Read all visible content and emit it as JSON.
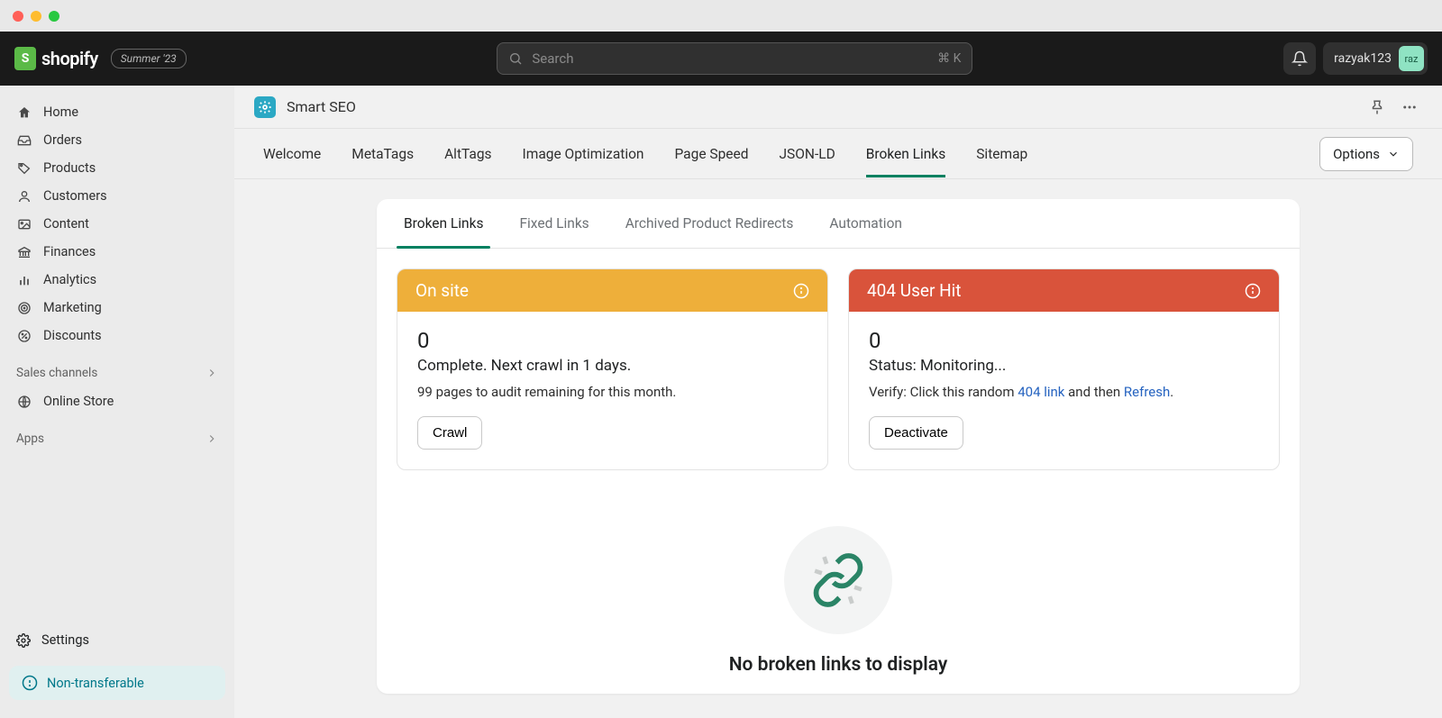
{
  "window_title": "shopify",
  "header": {
    "brand": "shopify",
    "badge": "Summer '23",
    "search_placeholder": "Search",
    "search_shortcut": "⌘ K",
    "username": "razyak123",
    "avatar_initials": "raz"
  },
  "sidebar": {
    "items": [
      {
        "label": "Home",
        "icon": "home"
      },
      {
        "label": "Orders",
        "icon": "inbox"
      },
      {
        "label": "Products",
        "icon": "tag"
      },
      {
        "label": "Customers",
        "icon": "user"
      },
      {
        "label": "Content",
        "icon": "image"
      },
      {
        "label": "Finances",
        "icon": "bank"
      },
      {
        "label": "Analytics",
        "icon": "bars"
      },
      {
        "label": "Marketing",
        "icon": "target"
      },
      {
        "label": "Discounts",
        "icon": "discount"
      }
    ],
    "sections": [
      {
        "label": "Sales channels"
      },
      {
        "label": "Apps"
      }
    ],
    "online_store": "Online Store",
    "settings": "Settings",
    "bottom_badge": "Non-transferable"
  },
  "app": {
    "title": "Smart SEO",
    "tabs": [
      "Welcome",
      "MetaTags",
      "AltTags",
      "Image Optimization",
      "Page Speed",
      "JSON-LD",
      "Broken Links",
      "Sitemap"
    ],
    "active_tab": "Broken Links",
    "options_label": "Options"
  },
  "subtabs": {
    "items": [
      "Broken Links",
      "Fixed Links",
      "Archived Product Redirects",
      "Automation"
    ],
    "active": "Broken Links"
  },
  "panels": {
    "onsite": {
      "title": "On site",
      "count": "0",
      "status": "Complete. Next crawl in 1 days.",
      "subtext": "99 pages to audit remaining for this month.",
      "button": "Crawl"
    },
    "userhit": {
      "title": "404 User Hit",
      "count": "0",
      "status": "Status: Monitoring...",
      "verify_prefix": "Verify: Click this random ",
      "verify_link1": "404 link",
      "verify_mid": " and then ",
      "verify_link2": "Refresh",
      "verify_suffix": ".",
      "button": "Deactivate"
    }
  },
  "empty_state": {
    "text": "No broken links to display"
  }
}
